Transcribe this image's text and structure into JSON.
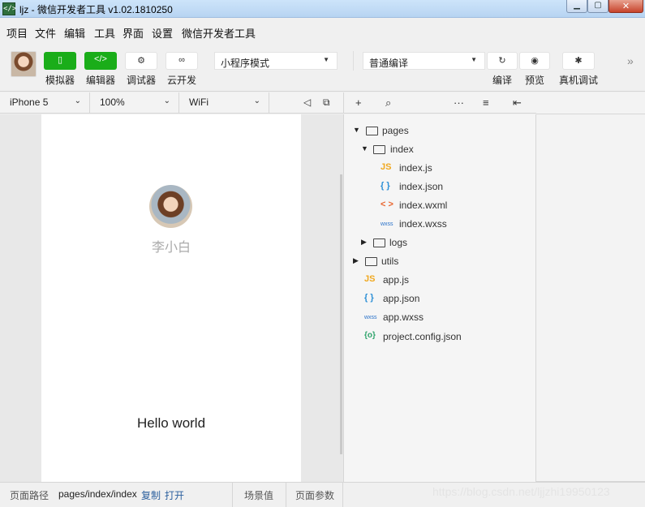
{
  "window": {
    "title": "ljz - 微信开发者工具 v1.02.1810250",
    "app_icon": "</>"
  },
  "menu": [
    "项目",
    "文件",
    "编辑",
    "工具",
    "界面",
    "设置",
    "微信开发者工具"
  ],
  "toolbar": {
    "buttons": [
      {
        "label": "模拟器",
        "icon": "phone-icon",
        "glyph": "▯",
        "style": "green"
      },
      {
        "label": "编辑器",
        "icon": "code-icon",
        "glyph": "</>",
        "style": "green"
      },
      {
        "label": "调试器",
        "icon": "debug-icon",
        "glyph": "⚙",
        "style": "white"
      },
      {
        "label": "云开发",
        "icon": "cloud-icon",
        "glyph": "∞",
        "style": "white"
      }
    ],
    "mode_select": "小程序模式",
    "compile_select": "普通编译",
    "right_buttons": [
      {
        "label": "编译",
        "icon": "refresh-icon",
        "glyph": "↻"
      },
      {
        "label": "预览",
        "icon": "eye-icon",
        "glyph": "◉"
      },
      {
        "label": "真机调试",
        "icon": "bug-icon",
        "glyph": "✱"
      }
    ],
    "more_glyph": "»"
  },
  "device_bar": {
    "device": "iPhone 5",
    "zoom": "100%",
    "network": "WiFi"
  },
  "simulator": {
    "nickname": "李小白",
    "motto": "Hello world"
  },
  "tree": {
    "items": [
      {
        "label": "pages",
        "kind": "folder",
        "open": true
      },
      {
        "label": "index",
        "kind": "folder",
        "open": true
      },
      {
        "label": "index.js",
        "kind": "js",
        "glyph": "JS"
      },
      {
        "label": "index.json",
        "kind": "json",
        "glyph": "{ }"
      },
      {
        "label": "index.wxml",
        "kind": "wxml",
        "glyph": "< >"
      },
      {
        "label": "index.wxss",
        "kind": "wxss",
        "glyph": "wxss"
      },
      {
        "label": "logs",
        "kind": "folder",
        "open": false
      },
      {
        "label": "utils",
        "kind": "folder",
        "open": false
      },
      {
        "label": "app.js",
        "kind": "js",
        "glyph": "JS"
      },
      {
        "label": "app.json",
        "kind": "json",
        "glyph": "{ }"
      },
      {
        "label": "app.wxss",
        "kind": "wxss",
        "glyph": "wxss"
      },
      {
        "label": "project.config.json",
        "kind": "config",
        "glyph": "{o}"
      }
    ]
  },
  "status": {
    "path_label": "页面路径",
    "path": "pages/index/index",
    "copy": "复制",
    "open": "打开",
    "scene": "场景值",
    "params": "页面参数"
  },
  "watermark": "https://blog.csdn.net/ljjzhi19950123",
  "colors": {
    "accent_green": "#1aad19",
    "js": "#f0a81f",
    "json": "#2b8fd6",
    "wxml": "#e8632c",
    "wxss": "#2770c9",
    "config": "#2ea36b"
  }
}
